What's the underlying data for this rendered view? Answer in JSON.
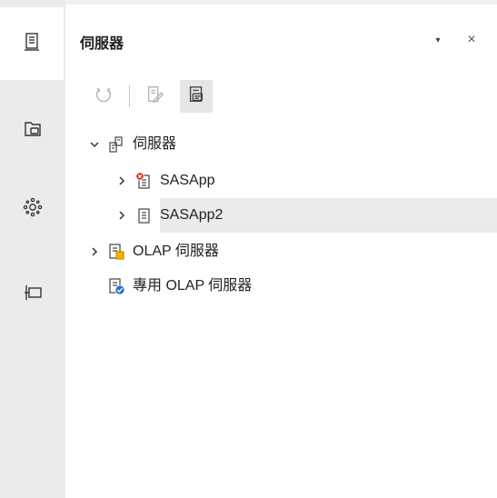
{
  "panel": {
    "title": "伺服器",
    "menu_glyph": "▾",
    "close_glyph": "×"
  },
  "rail": {
    "items": [
      {
        "icon": "server-icon",
        "active": true
      },
      {
        "icon": "folder-icon",
        "active": false
      },
      {
        "icon": "network-icon",
        "active": false
      },
      {
        "icon": "pin-icon",
        "active": false
      }
    ]
  },
  "toolbar": {
    "refresh": "refresh-icon",
    "edit": "edit-icon",
    "properties": "properties-icon"
  },
  "tree": {
    "root": {
      "label": "伺服器",
      "expanded": true
    },
    "sasapp": {
      "label": "SASApp",
      "status": "error",
      "expanded": false
    },
    "sasapp2": {
      "label": "SASApp2",
      "expanded": false,
      "selected": true
    },
    "olap": {
      "label": "OLAP 伺服器",
      "expanded": false
    },
    "dedicated_olap": {
      "label": "專用 OLAP 伺服器"
    }
  },
  "colors": {
    "rail_bg": "#ebebeb",
    "selected_bg": "#ebebeb",
    "error_red": "#d9261c",
    "badge_blue": "#1f6fd1",
    "badge_yellow": "#f0b400"
  }
}
